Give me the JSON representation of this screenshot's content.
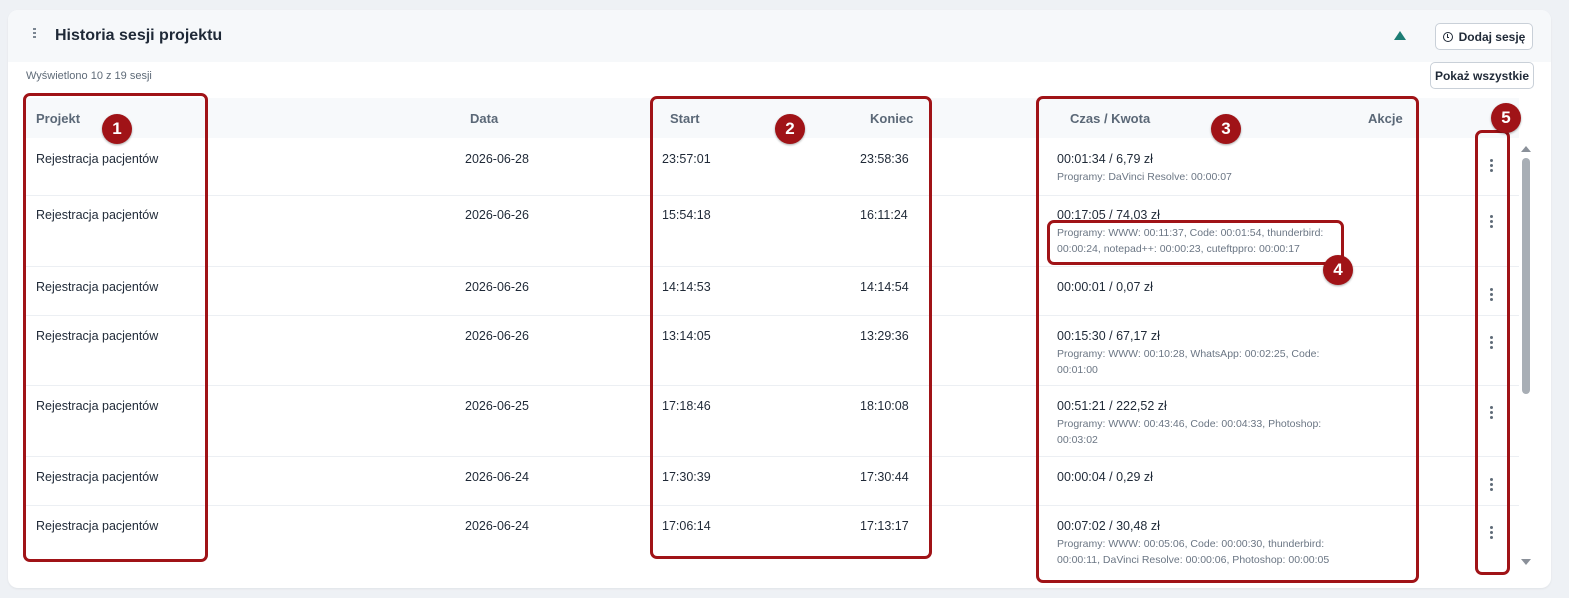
{
  "header": {
    "title": "Historia sesji projektu",
    "add_button": "Dodaj sesję",
    "show_all_button": "Pokaż wszystkie",
    "count_text": "Wyświetlono 10 z 19 sesji"
  },
  "table": {
    "columns": {
      "project": "Projekt",
      "date": "Data",
      "start": "Start",
      "end": "Koniec",
      "time_amount": "Czas / Kwota",
      "actions": "Akcje"
    },
    "rows": [
      {
        "project": "Rejestracja pacjentów",
        "date": "2026-06-28",
        "start": "23:57:01",
        "end": "23:58:36",
        "time_amount": "00:01:34 / 6,79 zł",
        "programs": "Programy: DaVinci Resolve: 00:00:07"
      },
      {
        "project": "Rejestracja pacjentów",
        "date": "2026-06-26",
        "start": "15:54:18",
        "end": "16:11:24",
        "time_amount": "00:17:05 / 74,03 zł",
        "programs": "Programy: WWW: 00:11:37, Code: 00:01:54, thunderbird: 00:00:24, notepad++: 00:00:23, cuteftppro: 00:00:17"
      },
      {
        "project": "Rejestracja pacjentów",
        "date": "2026-06-26",
        "start": "14:14:53",
        "end": "14:14:54",
        "time_amount": "00:00:01 / 0,07 zł",
        "programs": ""
      },
      {
        "project": "Rejestracja pacjentów",
        "date": "2026-06-26",
        "start": "13:14:05",
        "end": "13:29:36",
        "time_amount": "00:15:30 / 67,17 zł",
        "programs": "Programy: WWW: 00:10:28, WhatsApp: 00:02:25, Code: 00:01:00"
      },
      {
        "project": "Rejestracja pacjentów",
        "date": "2026-06-25",
        "start": "17:18:46",
        "end": "18:10:08",
        "time_amount": "00:51:21 / 222,52 zł",
        "programs": "Programy: WWW: 00:43:46, Code: 00:04:33, Photoshop: 00:03:02"
      },
      {
        "project": "Rejestracja pacjentów",
        "date": "2026-06-24",
        "start": "17:30:39",
        "end": "17:30:44",
        "time_amount": "00:00:04 / 0,29 zł",
        "programs": ""
      },
      {
        "project": "Rejestracja pacjentów",
        "date": "2026-06-24",
        "start": "17:06:14",
        "end": "17:13:17",
        "time_amount": "00:07:02 / 30,48 zł",
        "programs": "Programy: WWW: 00:05:06, Code: 00:00:30, thunderbird: 00:00:11, DaVinci Resolve: 00:00:06, Photoshop: 00:00:05"
      }
    ]
  },
  "annotations": [
    "1",
    "2",
    "3",
    "4",
    "5"
  ],
  "colors": {
    "accent": "#1c7d74",
    "highlight": "#a01317"
  }
}
